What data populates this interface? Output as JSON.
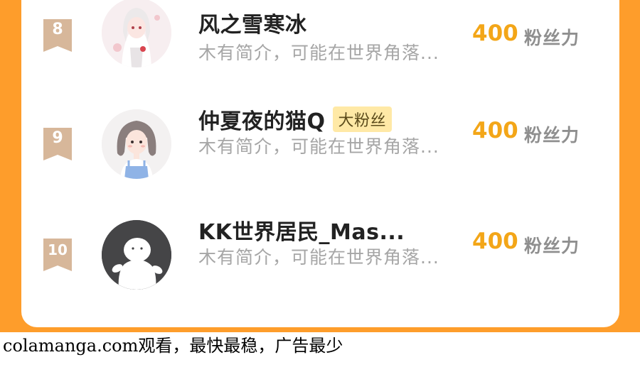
{
  "ranking": {
    "rows": [
      {
        "rank": "8",
        "name": "风之雪寒冰",
        "tag": "",
        "bio": "木有简介，可能在世界角落...",
        "score": "400",
        "unit": "粉丝力",
        "avatar": "anime-girl-avatar"
      },
      {
        "rank": "9",
        "name": "仲夏夜的猫Q",
        "tag": "大粉丝",
        "bio": "木有简介，可能在世界角落...",
        "score": "400",
        "unit": "粉丝力",
        "avatar": "illustrated-girl-avatar"
      },
      {
        "rank": "10",
        "name": "KK世界居民_Mas...",
        "tag": "",
        "bio": "木有简介，可能在世界角落...",
        "score": "400",
        "unit": "粉丝力",
        "avatar": "default-user-avatar"
      }
    ]
  },
  "colors": {
    "background": "#FE9D2B",
    "badge": "#D7B79A",
    "score": "#F3A618",
    "tag_bg": "#FFE9A6"
  },
  "footer": {
    "text": "colamanga.com观看，最快最稳，广告最少"
  }
}
